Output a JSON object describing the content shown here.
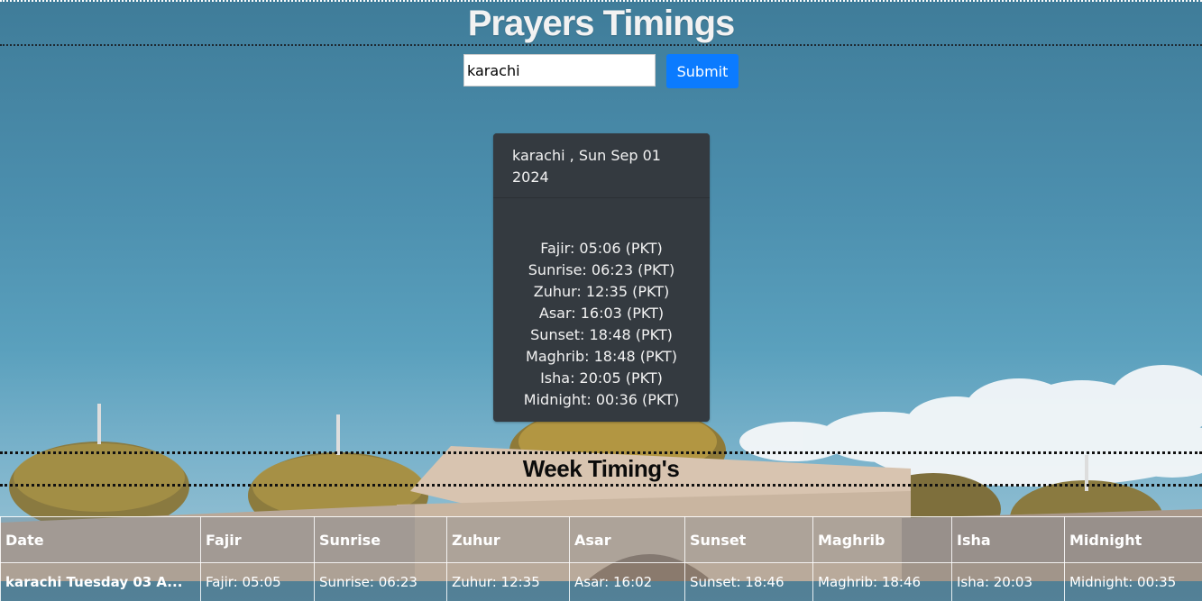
{
  "header": {
    "title": "Prayers Timings"
  },
  "search": {
    "value": "karachi",
    "submit_label": "Submit"
  },
  "card": {
    "header": "karachi , Sun Sep 01 2024",
    "timings": [
      "Fajir: 05:06 (PKT)",
      "Sunrise: 06:23 (PKT)",
      "Zuhur: 12:35 (PKT)",
      "Asar: 16:03 (PKT)",
      "Sunset: 18:48 (PKT)",
      "Maghrib: 18:48 (PKT)",
      "Isha: 20:05 (PKT)",
      "Midnight: 00:36 (PKT)"
    ]
  },
  "week": {
    "title": "Week Timing's",
    "columns": [
      "Date",
      "Fajir",
      "Sunrise",
      "Zuhur",
      "Asar",
      "Sunset",
      "Maghrib",
      "Isha",
      "Midnight"
    ],
    "rows": [
      [
        "karachi Tuesday 03 A...",
        "Fajir: 05:05",
        "Sunrise: 06:23",
        "Zuhur: 12:35",
        "Asar: 16:02",
        "Sunset: 18:46",
        "Maghrib: 18:46",
        "Isha: 20:03",
        "Midnight: 00:35"
      ]
    ]
  },
  "colors": {
    "accent": "#0b7bff",
    "card_bg": "#343a40",
    "title": "#f2f2f2"
  }
}
